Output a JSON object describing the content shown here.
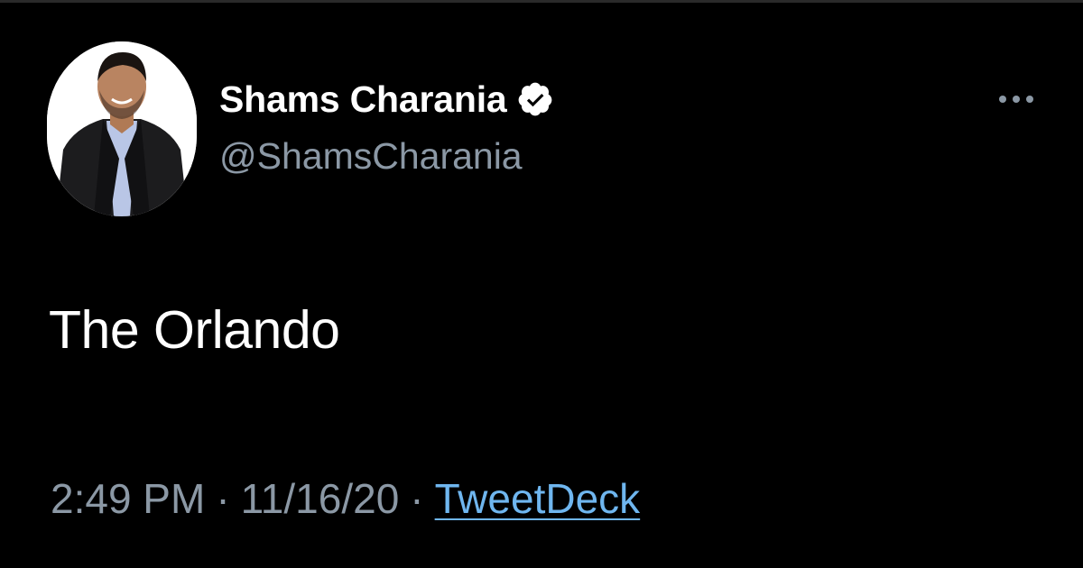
{
  "tweet": {
    "author": {
      "display_name": "Shams Charania",
      "handle": "@ShamsCharania",
      "verified": true,
      "avatar_icon": "profile-photo"
    },
    "text": "The Orlando",
    "meta": {
      "time": "2:49 PM",
      "separator": "·",
      "date": "11/16/20",
      "source": "TweetDeck"
    },
    "more_icon": "ellipsis-icon"
  },
  "colors": {
    "background": "#000000",
    "primary_text": "#ffffff",
    "secondary_text": "#8b98a5",
    "link": "#6fb6ef"
  }
}
